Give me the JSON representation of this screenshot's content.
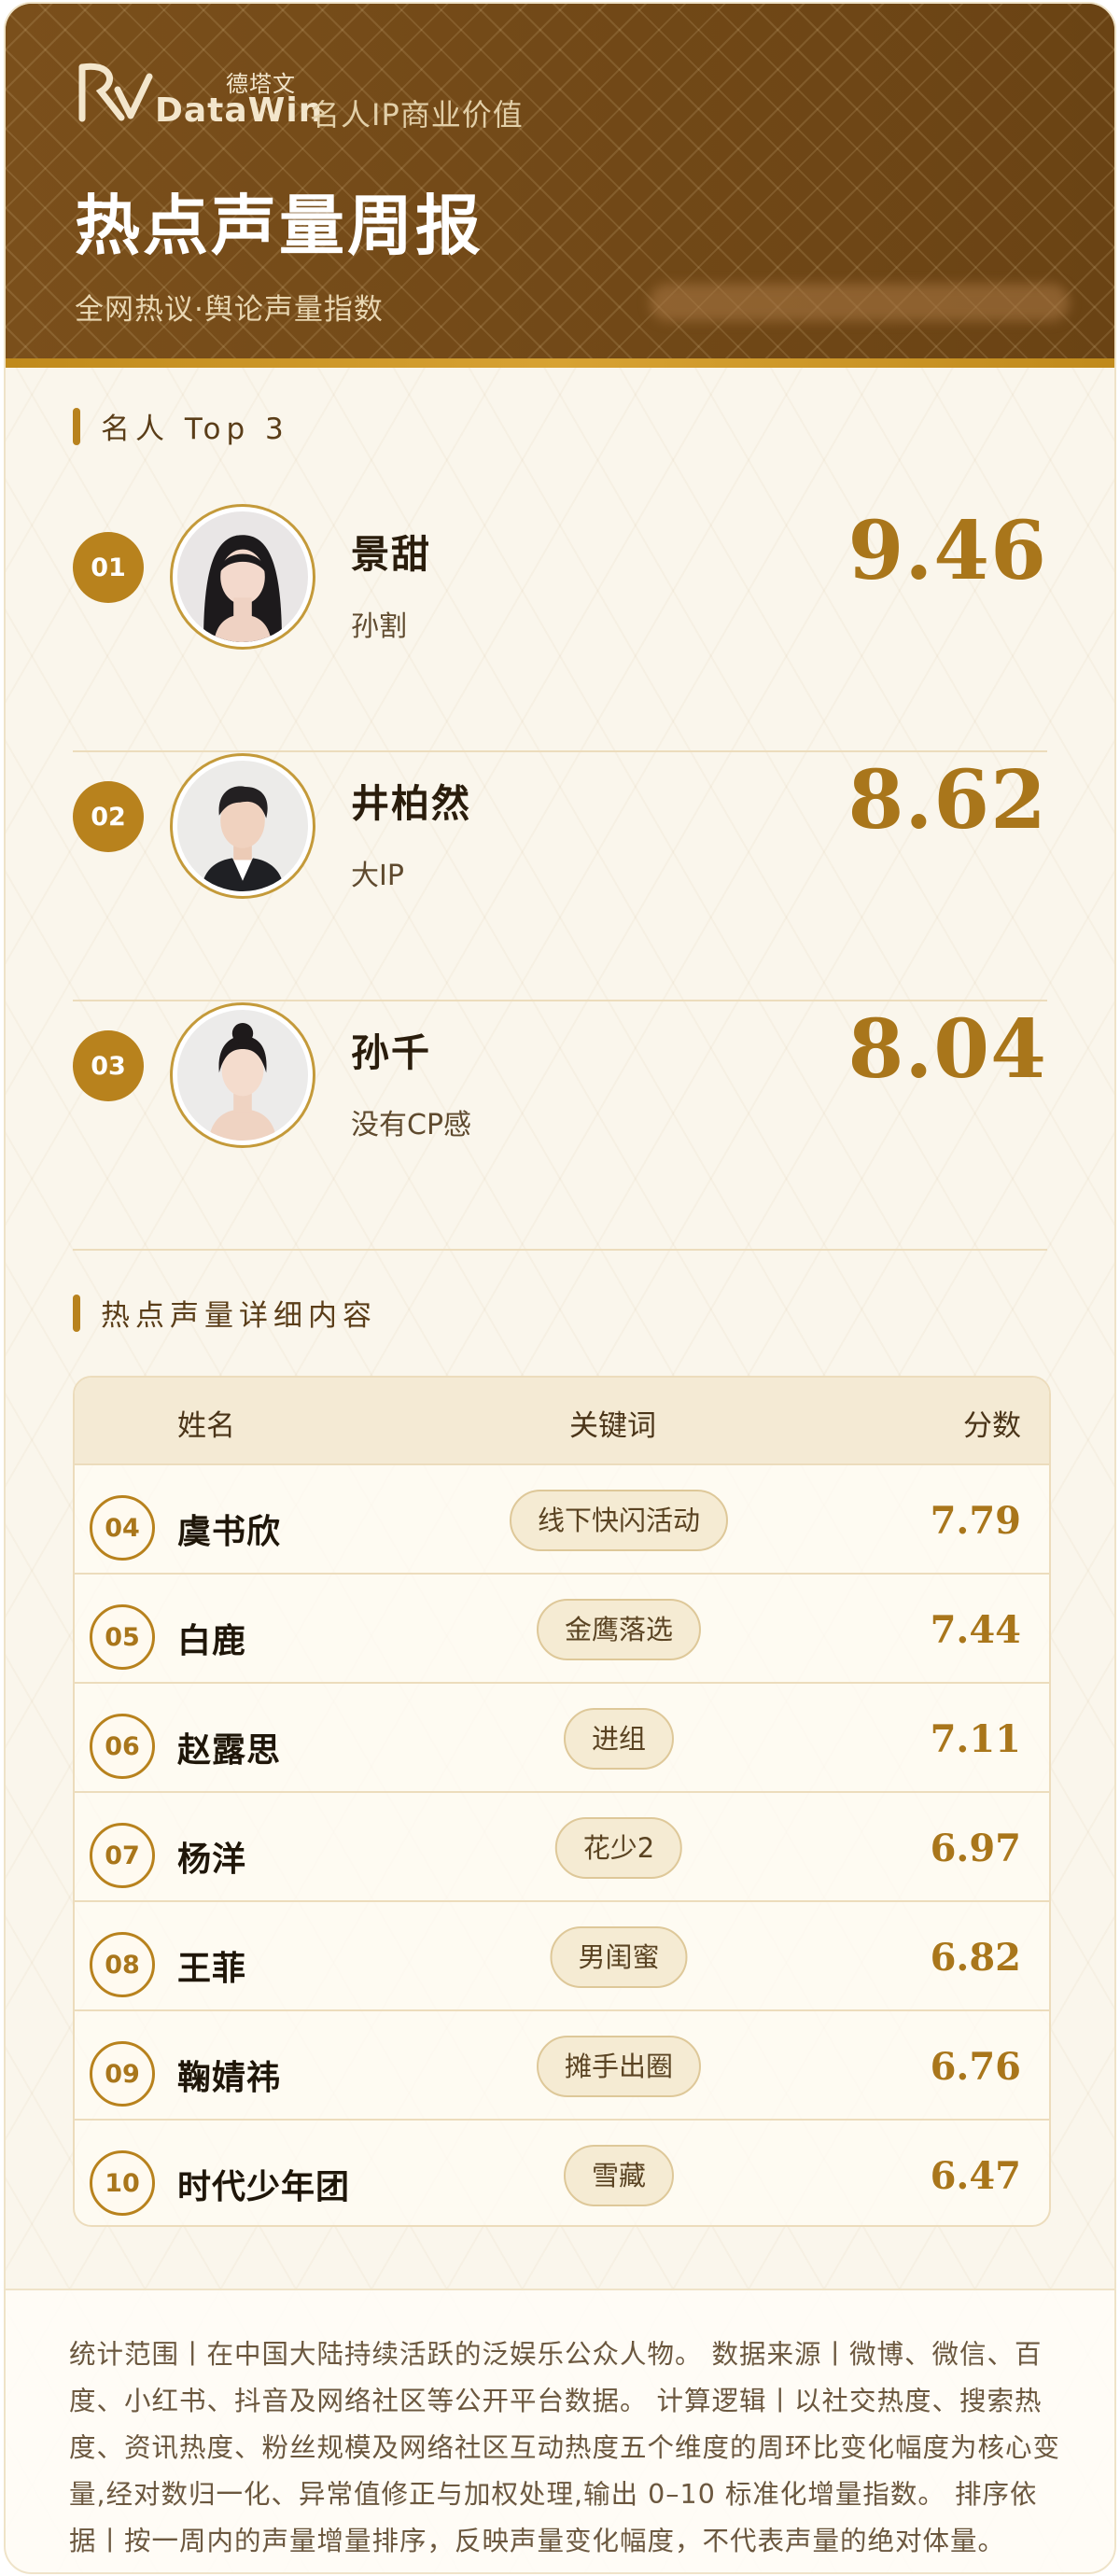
{
  "brand": {
    "name_cn": "德塔文",
    "name_en": "DataWin",
    "tagline": "名人IP商业价值"
  },
  "report": {
    "title": "热点声量周报",
    "subtitle": "全网热议·舆论声量指数"
  },
  "top3": {
    "section_title": "名人 Top 3",
    "items": [
      {
        "rank": "01",
        "name": "景甜",
        "tag": "孙割",
        "score": "9.46"
      },
      {
        "rank": "02",
        "name": "井柏然",
        "tag": "大IP",
        "score": "8.62"
      },
      {
        "rank": "03",
        "name": "孙千",
        "tag": "没有CP感",
        "score": "8.04"
      }
    ]
  },
  "detail": {
    "section_title": "热点声量详细内容",
    "columns": {
      "name": "姓名",
      "keyword": "关键词",
      "score": "分数"
    },
    "rows": [
      {
        "rank": "04",
        "name": "虞书欣",
        "keyword": "线下快闪活动",
        "score": "7.79"
      },
      {
        "rank": "05",
        "name": "白鹿",
        "keyword": "金鹰落选",
        "score": "7.44"
      },
      {
        "rank": "06",
        "name": "赵露思",
        "keyword": "进组",
        "score": "7.11"
      },
      {
        "rank": "07",
        "name": "杨洋",
        "keyword": "花少2",
        "score": "6.97"
      },
      {
        "rank": "08",
        "name": "王菲",
        "keyword": "男闺蜜",
        "score": "6.82"
      },
      {
        "rank": "09",
        "name": "鞠婧祎",
        "keyword": "摊手出圈",
        "score": "6.76"
      },
      {
        "rank": "10",
        "name": "时代少年团",
        "keyword": "雪藏",
        "score": "6.47"
      }
    ]
  },
  "footer": {
    "text": "统计范围丨在中国大陆持续活跃的泛娱乐公众人物。 数据来源丨微博、微信、百度、小红书、抖音及网络社区等公开平台数据。 计算逻辑丨以社交热度、搜索热度、资讯热度、粉丝规模及网络社区互动热度五个维度的周环比变化幅度为核心变量,经对数归一化、异常值修正与加权处理,输出 0–10 标准化增量指数。 排序依据丨按一周内的声量增量排序，反映声量变化幅度，不代表声量的绝对体量。"
  },
  "colors": {
    "header_brown": "#6e4716",
    "accent_gold": "#b8821d",
    "score_gold": "#a9761b",
    "background_cream": "#faf6ec"
  }
}
